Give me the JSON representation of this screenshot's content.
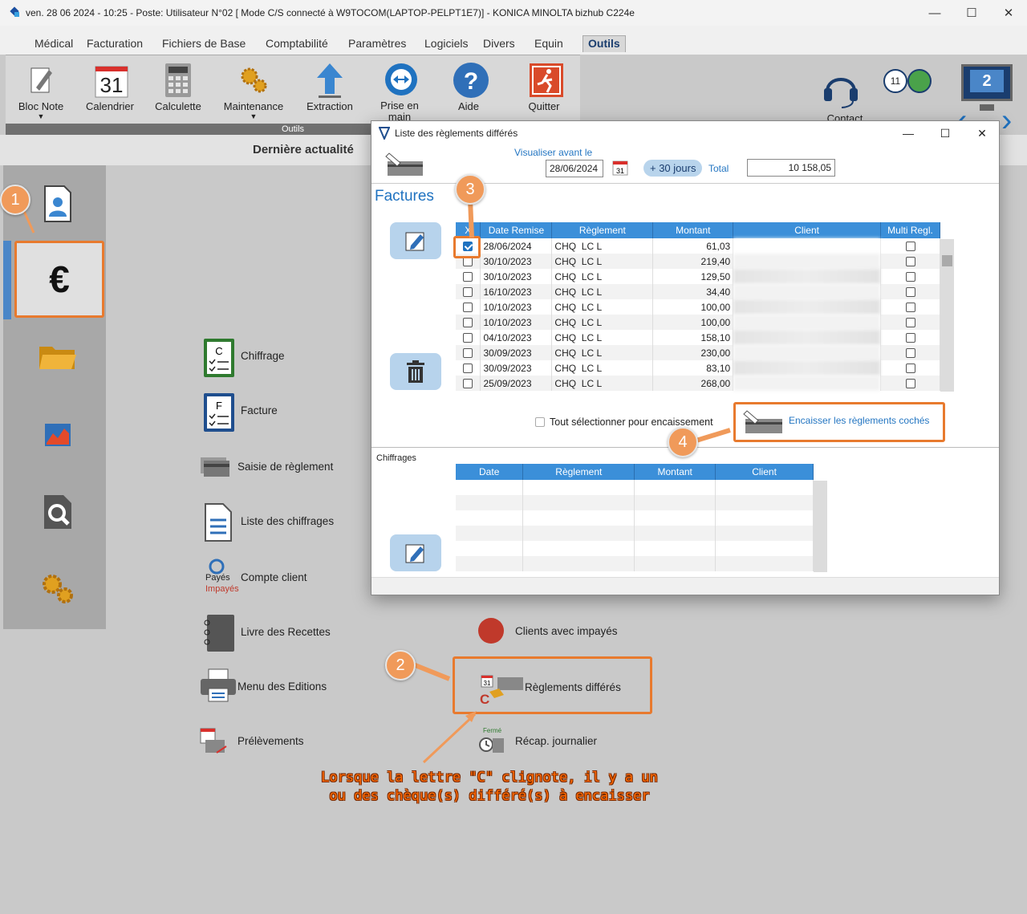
{
  "window": {
    "title": "ven. 28 06 2024 - 10:25 - Poste: Utilisateur N°02  [ Mode C/S connecté à W9TOCOM(LAPTOP-PELPT1E7)] - KONICA MINOLTA bizhub C224e"
  },
  "menu": [
    "Médical",
    "Facturation",
    "Fichiers de Base",
    "Comptabilité",
    "Paramètres",
    "Logiciels",
    "Divers",
    "Equin",
    "Outils"
  ],
  "ribbon": {
    "group_label": "Outils",
    "buttons": [
      "Bloc Note",
      "Calendrier",
      "Calculette",
      "Maintenance",
      "Extraction",
      "Prise en main",
      "Aide",
      "Quitter"
    ],
    "calendar_day": "31",
    "contact_label": "Contact",
    "badge_count": "11",
    "screen_number": "2"
  },
  "subheader": "Dernière actualité",
  "main_items": {
    "chiffrage": "Chiffrage",
    "facture": "Facture",
    "saisie": "Saisie de règlement",
    "liste_chiffrages": "Liste des chiffrages",
    "compte_client": "Compte client",
    "payes": "Payés",
    "impayes": "Impayés",
    "livre": "Livre des Recettes",
    "menu_editions": "Menu des Editions",
    "prelevements": "Prélèvements",
    "clients_impayes": "Clients avec  impayés",
    "reglements_differes": "Règlements différés",
    "recap": "Récap. journalier",
    "ferme": "Fermé",
    "c_letter": "C"
  },
  "callouts": [
    "1",
    "2",
    "3",
    "4"
  ],
  "annotation": [
    "Lorsque la lettre \"C\" clignote, il y a un",
    "ou des chèque(s) différé(s) à encaisser"
  ],
  "dialog": {
    "title": "Liste des règlements différés",
    "visualiser_label": "Visualiser avant le",
    "date_value": "28/06/2024",
    "cal_day": "31",
    "plus30": "+ 30 jours",
    "total_label": "Total",
    "total_value": "10 158,05",
    "factures_title": "Factures",
    "columns": [
      "X",
      "Date Remise",
      "Règlement",
      "Montant",
      "Client",
      "Multi Regl."
    ],
    "rows": [
      {
        "checked": true,
        "date": "28/06/2024",
        "mode": "CHQ",
        "code": "LC L",
        "montant": "61,03"
      },
      {
        "checked": false,
        "date": "30/10/2023",
        "mode": "CHQ",
        "code": "LC L",
        "montant": "219,40"
      },
      {
        "checked": false,
        "date": "30/10/2023",
        "mode": "CHQ",
        "code": "LC L",
        "montant": "129,50"
      },
      {
        "checked": false,
        "date": "16/10/2023",
        "mode": "CHQ",
        "code": "LC L",
        "montant": "34,40"
      },
      {
        "checked": false,
        "date": "10/10/2023",
        "mode": "CHQ",
        "code": "LC L",
        "montant": "100,00"
      },
      {
        "checked": false,
        "date": "10/10/2023",
        "mode": "CHQ",
        "code": "LC L",
        "montant": "100,00"
      },
      {
        "checked": false,
        "date": "04/10/2023",
        "mode": "CHQ",
        "code": "LC L",
        "montant": "158,10"
      },
      {
        "checked": false,
        "date": "30/09/2023",
        "mode": "CHQ",
        "code": "LC L",
        "montant": "230,00"
      },
      {
        "checked": false,
        "date": "30/09/2023",
        "mode": "CHQ",
        "code": "LC L",
        "montant": "83,10"
      },
      {
        "checked": false,
        "date": "25/09/2023",
        "mode": "CHQ",
        "code": "LC L",
        "montant": "268,00"
      }
    ],
    "select_all": "Tout sélectionner pour encaissement",
    "encaisser": "Encaisser les règlements cochés",
    "chiffrages_label": "Chiffrages",
    "chiffrages_columns": [
      "Date",
      "Règlement",
      "Montant",
      "Client"
    ]
  },
  "colors": {
    "accent": "#1f72c0",
    "highlight": "#e87a2e",
    "callout": "#f09a5a",
    "header_blue": "#3b8fd9"
  }
}
